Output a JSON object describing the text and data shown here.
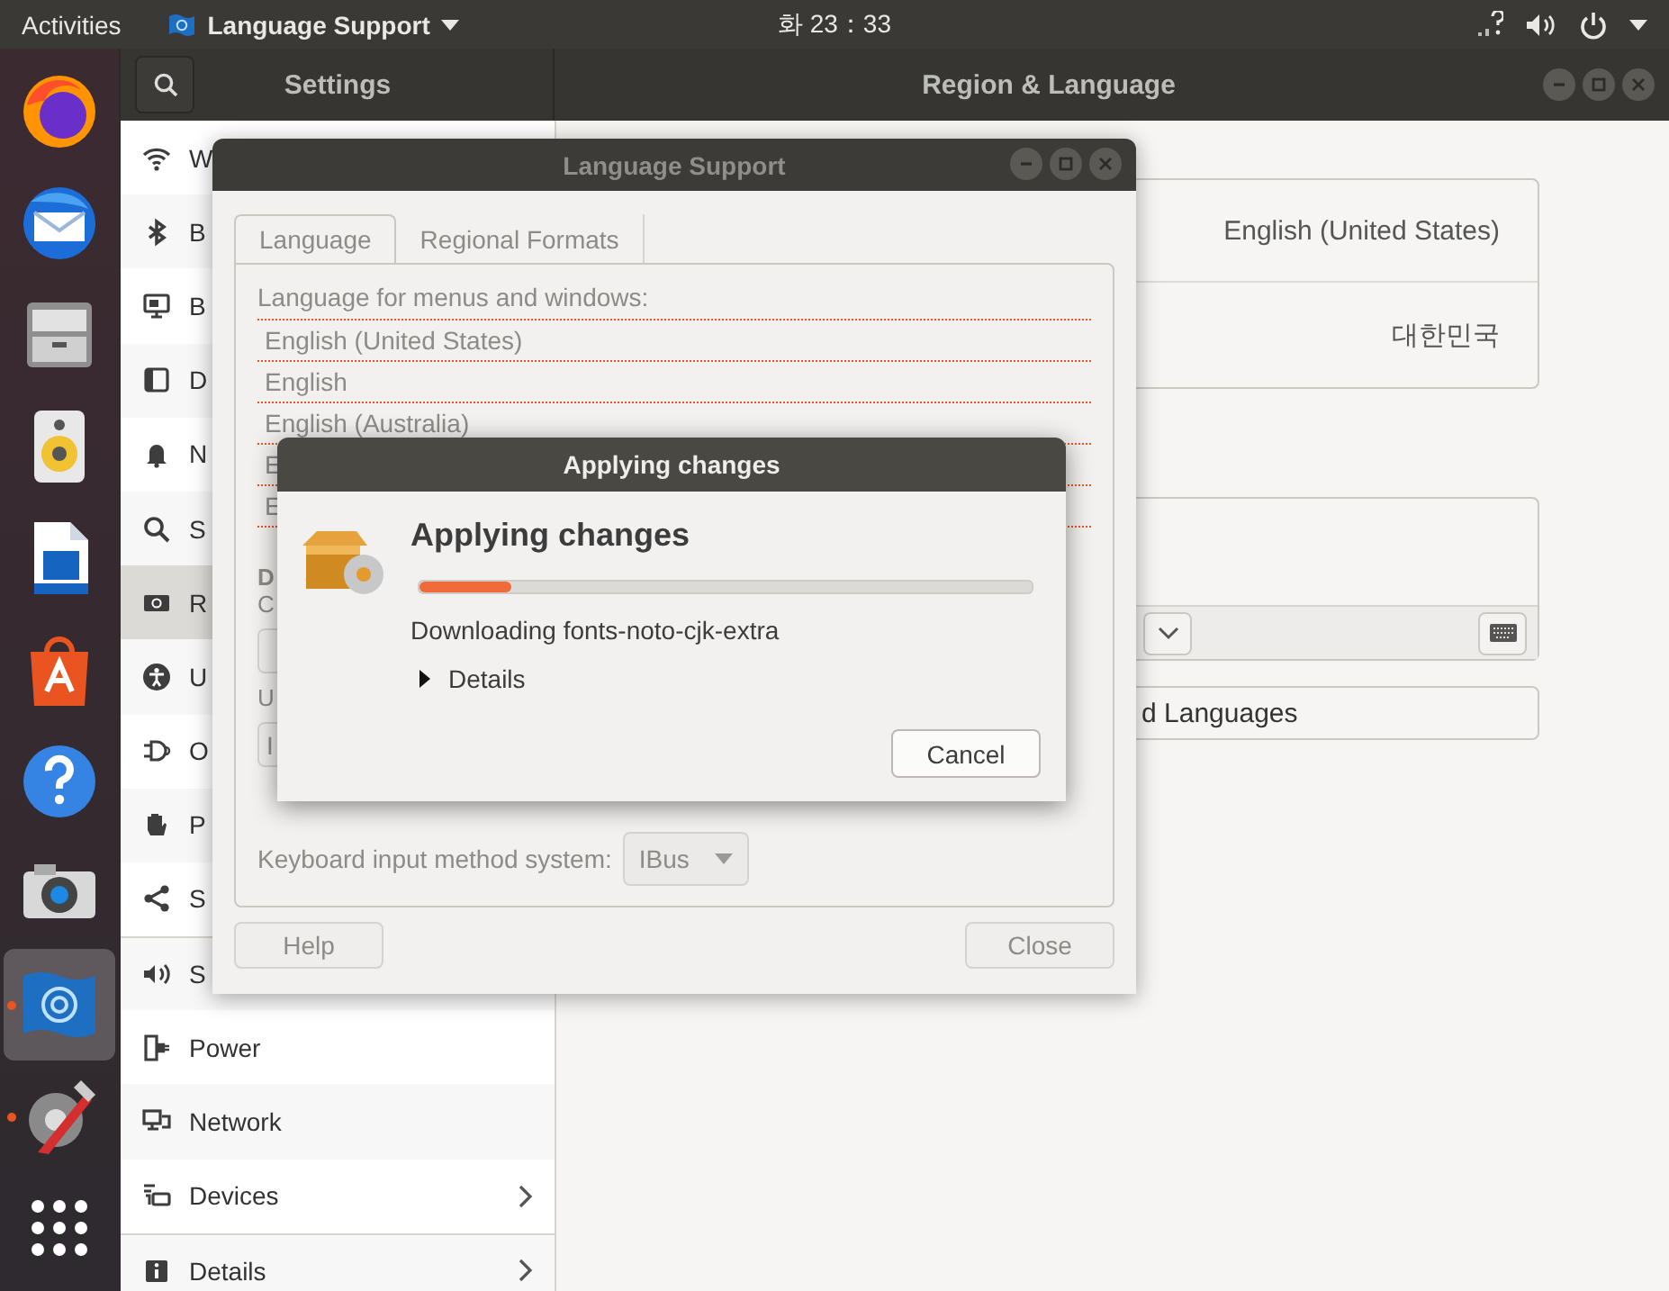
{
  "top_bar": {
    "activities": "Activities",
    "app_menu": "Language Support",
    "clock": "화 23：33"
  },
  "dock": {
    "items": [
      {
        "kind": "browser",
        "running": false,
        "focused": false
      },
      {
        "kind": "mail",
        "running": false,
        "focused": false
      },
      {
        "kind": "files",
        "running": false,
        "focused": false
      },
      {
        "kind": "music",
        "running": false,
        "focused": false
      },
      {
        "kind": "writer",
        "running": false,
        "focused": false
      },
      {
        "kind": "store",
        "running": false,
        "focused": false
      },
      {
        "kind": "help",
        "running": false,
        "focused": false
      },
      {
        "kind": "camera",
        "running": false,
        "focused": false
      },
      {
        "kind": "language",
        "running": true,
        "focused": true
      },
      {
        "kind": "settings",
        "running": true,
        "focused": false
      },
      {
        "kind": "apps",
        "running": false,
        "focused": false
      }
    ]
  },
  "settings_window": {
    "title": "Settings",
    "panel_title": "Region & Language",
    "sidebar": {
      "items": [
        {
          "label": "W",
          "kind": "wifi",
          "selected": false,
          "submenu": false
        },
        {
          "label": "B",
          "kind": "bluetooth",
          "selected": false,
          "submenu": false
        },
        {
          "label": "B",
          "kind": "background",
          "selected": false,
          "submenu": false
        },
        {
          "label": "D",
          "kind": "dock",
          "selected": false,
          "submenu": false
        },
        {
          "label": "N",
          "kind": "notifications",
          "selected": false,
          "submenu": false
        },
        {
          "label": "S",
          "kind": "search",
          "selected": false,
          "submenu": false
        },
        {
          "label": "R",
          "kind": "region",
          "selected": true,
          "submenu": false
        },
        {
          "label": "U",
          "kind": "access",
          "selected": false,
          "submenu": false
        },
        {
          "label": "O",
          "kind": "online",
          "selected": false,
          "submenu": false
        },
        {
          "label": "P",
          "kind": "privacy",
          "selected": false,
          "submenu": false
        },
        {
          "label": "S",
          "kind": "sharing",
          "selected": false,
          "submenu": false
        },
        {
          "label": "S",
          "kind": "sound",
          "selected": false,
          "submenu": false
        },
        {
          "label": "Power",
          "kind": "power",
          "selected": false,
          "submenu": false
        },
        {
          "label": "Network",
          "kind": "network",
          "selected": false,
          "submenu": false
        },
        {
          "label": "Devices",
          "kind": "devices",
          "selected": false,
          "submenu": true
        },
        {
          "label": "Details",
          "kind": "details",
          "selected": false,
          "submenu": true
        }
      ]
    },
    "language_value": "English (United States)",
    "formats_value": "대한민국",
    "manage_button": "d Languages"
  },
  "language_support": {
    "title": "Language Support",
    "insensitive": true,
    "tabs": [
      {
        "label": "Language",
        "selected": true
      },
      {
        "label": "Regional Formats",
        "selected": false
      }
    ],
    "list_label": "Language for menus and windows:",
    "languages": [
      "English (United States)",
      "English",
      "English (Australia)",
      "E",
      "E"
    ],
    "drag_hint": "D",
    "drag_hint_2": "C",
    "use_label": "U",
    "install_button": "I",
    "input_method_label": "Keyboard input method system:",
    "input_method_value": "IBus",
    "help_button": "Help",
    "close_button": "Close"
  },
  "progress_dialog": {
    "title": "Applying changes",
    "heading": "Applying changes",
    "level": 0.15,
    "status": "Downloading fonts-noto-cjk-extra",
    "details": {
      "label": "Details",
      "expanded": false
    },
    "cancel_button": "Cancel"
  }
}
